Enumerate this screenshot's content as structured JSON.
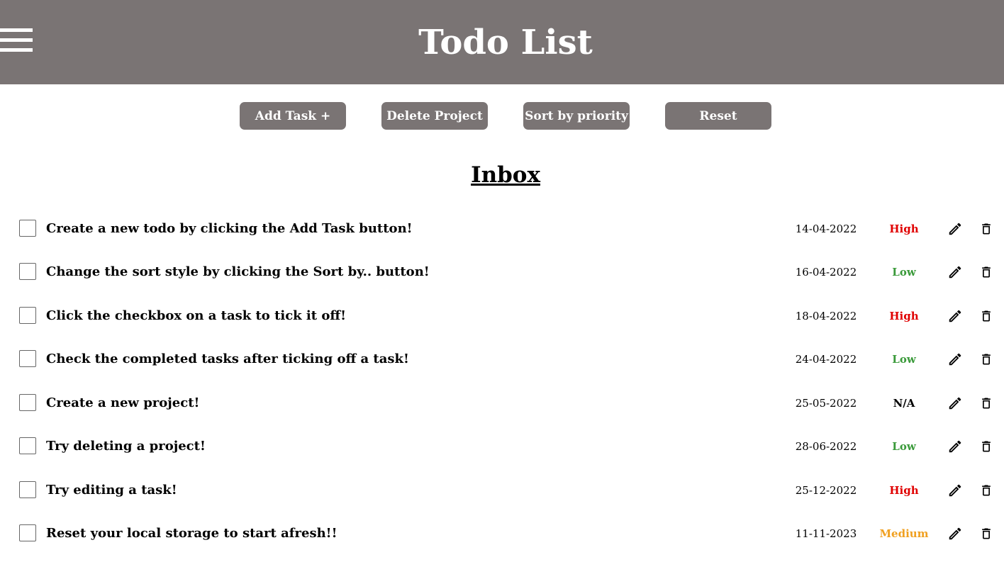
{
  "header": {
    "title": "Todo List",
    "menu_icon": "hamburger-menu-icon"
  },
  "toolbar": {
    "add_task_label": "Add Task +",
    "delete_project_label": "Delete Project",
    "sort_label": "Sort by priority",
    "reset_label": "Reset"
  },
  "project": {
    "title": "Inbox"
  },
  "priority_colors": {
    "High": "#e00000",
    "Low": "#3a9a3a",
    "N/A": "#000000",
    "Medium": "#f0a020"
  },
  "tasks": [
    {
      "text": "Create a new todo by clicking the Add Task button!",
      "date": "14-04-2022",
      "priority": "High"
    },
    {
      "text": "Change the sort style by clicking the Sort by.. button!",
      "date": "16-04-2022",
      "priority": "Low"
    },
    {
      "text": "Click the checkbox on a task to tick it off!",
      "date": "18-04-2022",
      "priority": "High"
    },
    {
      "text": "Check the completed tasks after ticking off a task!",
      "date": "24-04-2022",
      "priority": "Low"
    },
    {
      "text": "Create a new project!",
      "date": "25-05-2022",
      "priority": "N/A"
    },
    {
      "text": "Try deleting a project!",
      "date": "28-06-2022",
      "priority": "Low"
    },
    {
      "text": "Try editing a task!",
      "date": "25-12-2022",
      "priority": "High"
    },
    {
      "text": "Reset your local storage to start afresh!!",
      "date": "11-11-2023",
      "priority": "Medium"
    }
  ]
}
